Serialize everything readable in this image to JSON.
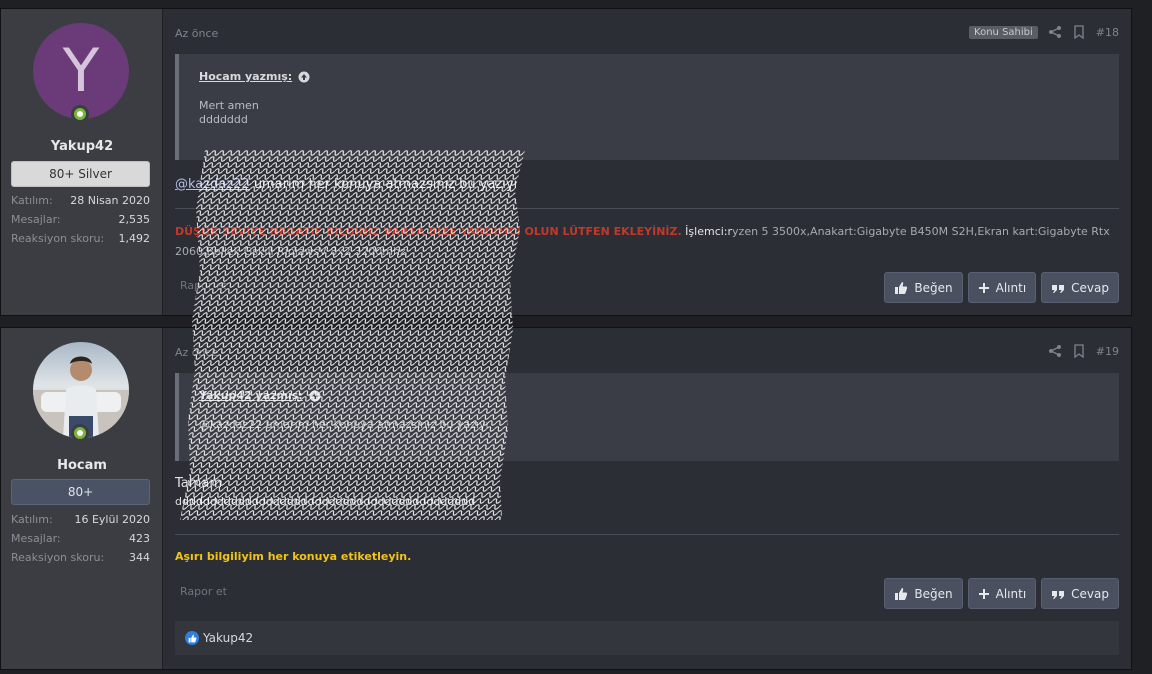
{
  "posts": [
    {
      "user": {
        "avatar_letter": "Y",
        "name": "Yakup42",
        "title": "80+ Silver",
        "stats": [
          {
            "label": "Katılım:",
            "value": "28 Nisan 2020"
          },
          {
            "label": "Mesajlar:",
            "value": "2,535"
          },
          {
            "label": "Reaksiyon skoru:",
            "value": "1,492"
          }
        ]
      },
      "date": "Az önce",
      "owner_badge": "Konu Sahibi",
      "number": "#18",
      "quote": {
        "author": "Hocam yazmış:",
        "text": "Mert amen",
        "extra": "ddddddd"
      },
      "message": {
        "mention": "@kazdaz22",
        "text": " umarım her konuya atmazsınız bu yazıyı"
      },
      "signature": {
        "red": "DÜŞÜK SEVİYE NEGATİF BİLGİNİZ VARSA BİZE YARDIMCI OLUN LÜTFEN EKLEYİNİZ.",
        "white": " İşlemci:r",
        "rest": "yzen 5 3500x,Anakart:Gigabyte B450M S2H,Ekran kart:Gigabyte Rtx 2060,Bellek:Gskill RipjawsV 8x2 3200mhz"
      },
      "report": "Rapor et",
      "actions": [
        "Beğen",
        "Alıntı",
        "Cevap"
      ]
    },
    {
      "user": {
        "name": "Hocam",
        "title": "80+",
        "stats": [
          {
            "label": "Katılım:",
            "value": "16 Eylül 2020"
          },
          {
            "label": "Mesajlar:",
            "value": "423"
          },
          {
            "label": "Reaksiyon skoru:",
            "value": "344"
          }
        ]
      },
      "date": "Az önce",
      "number": "#19",
      "quote": {
        "author": "Yakup42 yazmış:",
        "text": "@kazdaz22 umarım her konuya atmazsınız bu yazıyı"
      },
      "message": {
        "text": "Tamam",
        "extra": "ddddddddddddddddddddddddddddddddddddddddddd"
      },
      "signature": {
        "yellow": "Aşırı bilgiliyim her konuya etiketleyin."
      },
      "report": "Rapor et",
      "actions": [
        "Beğen",
        "Alıntı",
        "Cevap"
      ],
      "reaction_user": "Yakup42"
    }
  ],
  "colors": {
    "accent": "#6b3a78",
    "online": "#7ab63a",
    "like": "#2f7fe0",
    "sig_red": "#c0392b",
    "sig_yellow": "#f0c419"
  }
}
